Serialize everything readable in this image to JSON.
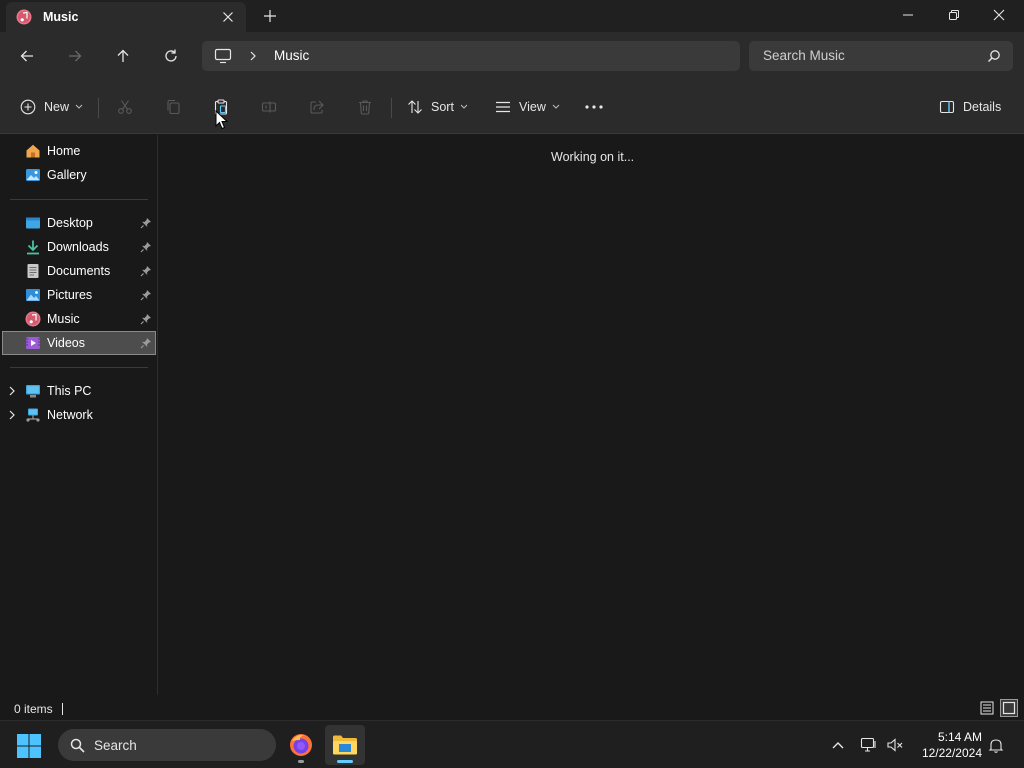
{
  "window": {
    "tab_title": "Music",
    "controls": {
      "minimize": "minimize",
      "restore": "restore",
      "close": "close"
    }
  },
  "address": {
    "breadcrumb": [
      "Music"
    ],
    "search_placeholder": "Search Music"
  },
  "commandbar": {
    "new_label": "New",
    "sort_label": "Sort",
    "view_label": "View",
    "details_label": "Details"
  },
  "sidebar": {
    "top": [
      {
        "label": "Home",
        "icon": "home-icon"
      },
      {
        "label": "Gallery",
        "icon": "gallery-icon"
      }
    ],
    "quick_access": [
      {
        "label": "Desktop",
        "icon": "desktop-folder-icon",
        "pinned": true
      },
      {
        "label": "Downloads",
        "icon": "downloads-folder-icon",
        "pinned": true
      },
      {
        "label": "Documents",
        "icon": "documents-folder-icon",
        "pinned": true
      },
      {
        "label": "Pictures",
        "icon": "pictures-folder-icon",
        "pinned": true
      },
      {
        "label": "Music",
        "icon": "music-folder-icon",
        "pinned": true
      },
      {
        "label": "Videos",
        "icon": "videos-folder-icon",
        "pinned": true,
        "selected": true
      }
    ],
    "locations": [
      {
        "label": "This PC",
        "icon": "this-pc-icon"
      },
      {
        "label": "Network",
        "icon": "network-icon"
      }
    ]
  },
  "content": {
    "status_message": "Working on it..."
  },
  "statusbar": {
    "item_count": "0 items"
  },
  "taskbar": {
    "search_label": "Search",
    "time": "5:14 AM",
    "date": "12/22/2024"
  },
  "colors": {
    "accent": "#60cdff",
    "window_bg": "#191919",
    "chrome_bg": "#2b2b2b",
    "selected_bg": "#4d4d4d"
  }
}
